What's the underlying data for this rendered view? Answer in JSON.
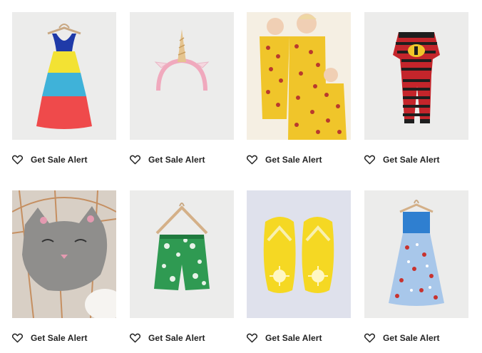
{
  "products": [
    {
      "image": "tiered-rainbow-dress",
      "alert_label": "Get Sale Alert",
      "icon": "heart-icon"
    },
    {
      "image": "unicorn-headband",
      "alert_label": "Get Sale Alert",
      "icon": "heart-icon"
    },
    {
      "image": "ladybug-family-pajamas",
      "alert_label": "Get Sale Alert",
      "icon": "heart-icon"
    },
    {
      "image": "incredibles-striped-pajamas",
      "alert_label": "Get Sale Alert",
      "icon": "heart-icon"
    },
    {
      "image": "gray-cat-pillow",
      "alert_label": "Get Sale Alert",
      "icon": "heart-icon"
    },
    {
      "image": "palm-print-swim-trunks",
      "alert_label": "Get Sale Alert",
      "icon": "heart-icon"
    },
    {
      "image": "yellow-sun-flip-flops",
      "alert_label": "Get Sale Alert",
      "icon": "heart-icon"
    },
    {
      "image": "ladybug-tulle-dress",
      "alert_label": "Get Sale Alert",
      "icon": "heart-icon"
    }
  ],
  "colors": {
    "text": "#222222",
    "image_bg": "#e8e7e6"
  }
}
